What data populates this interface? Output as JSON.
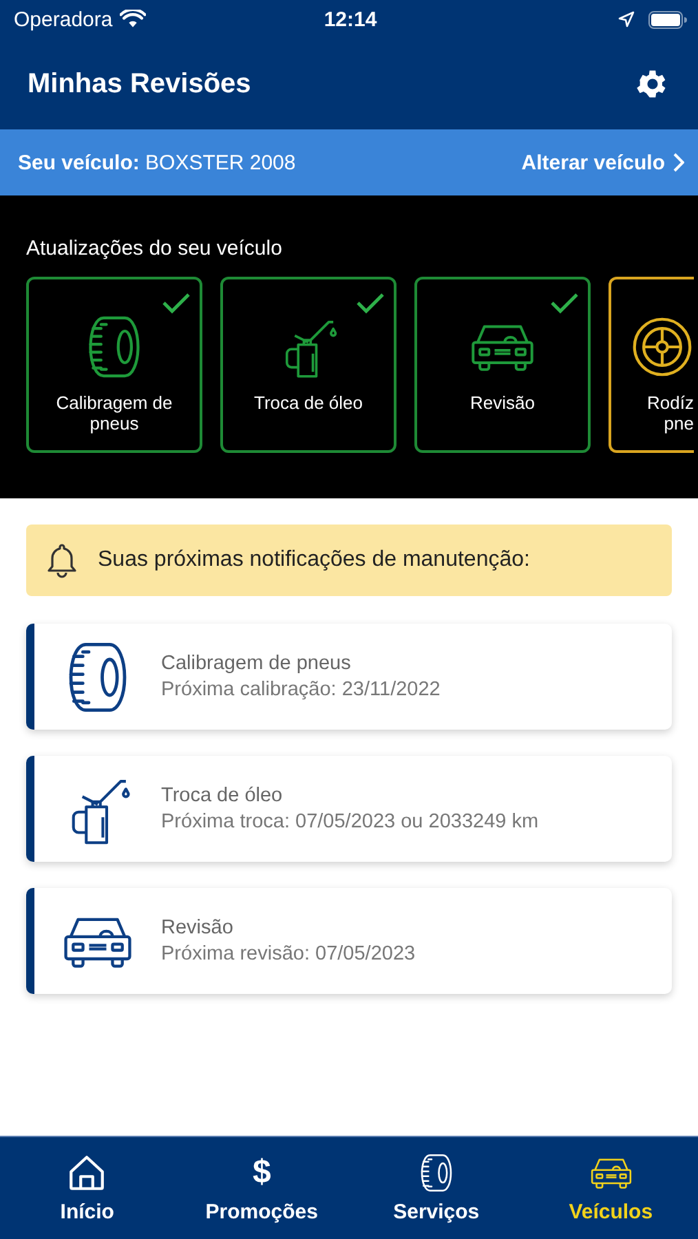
{
  "status_bar": {
    "carrier": "Operadora",
    "time": "12:14"
  },
  "header": {
    "title": "Minhas Revisões"
  },
  "vehicle_bar": {
    "label": "Seu veículo:",
    "value": "BOXSTER 2008",
    "action": "Alterar veículo"
  },
  "updates": {
    "title": "Atualizações do seu veículo",
    "items": [
      {
        "kind": "tire",
        "label": "Calibragem de pneus",
        "done": true
      },
      {
        "kind": "oil",
        "label": "Troca de óleo",
        "done": true
      },
      {
        "kind": "car",
        "label": "Revisão",
        "done": true
      },
      {
        "kind": "wheel",
        "label": "Rodíz pne",
        "done": false,
        "partial": true
      }
    ]
  },
  "notice": {
    "text": "Suas próximas notificações de manutenção:"
  },
  "reminders": [
    {
      "kind": "tire",
      "title": "Calibragem de pneus",
      "detail": "Próxima calibração: 23/11/2022"
    },
    {
      "kind": "oil",
      "title": "Troca de óleo",
      "detail": "Próxima troca: 07/05/2023 ou 2033249 km"
    },
    {
      "kind": "car",
      "title": "Revisão",
      "detail": "Próxima revisão: 07/05/2023"
    }
  ],
  "tab_bar": [
    {
      "kind": "home",
      "label": "Início",
      "selected": false
    },
    {
      "kind": "dollar",
      "icon": "$",
      "label": "Promoções",
      "selected": false
    },
    {
      "kind": "tire",
      "label": "Serviços",
      "selected": false
    },
    {
      "kind": "car",
      "label": "Veículos",
      "selected": true
    }
  ]
}
